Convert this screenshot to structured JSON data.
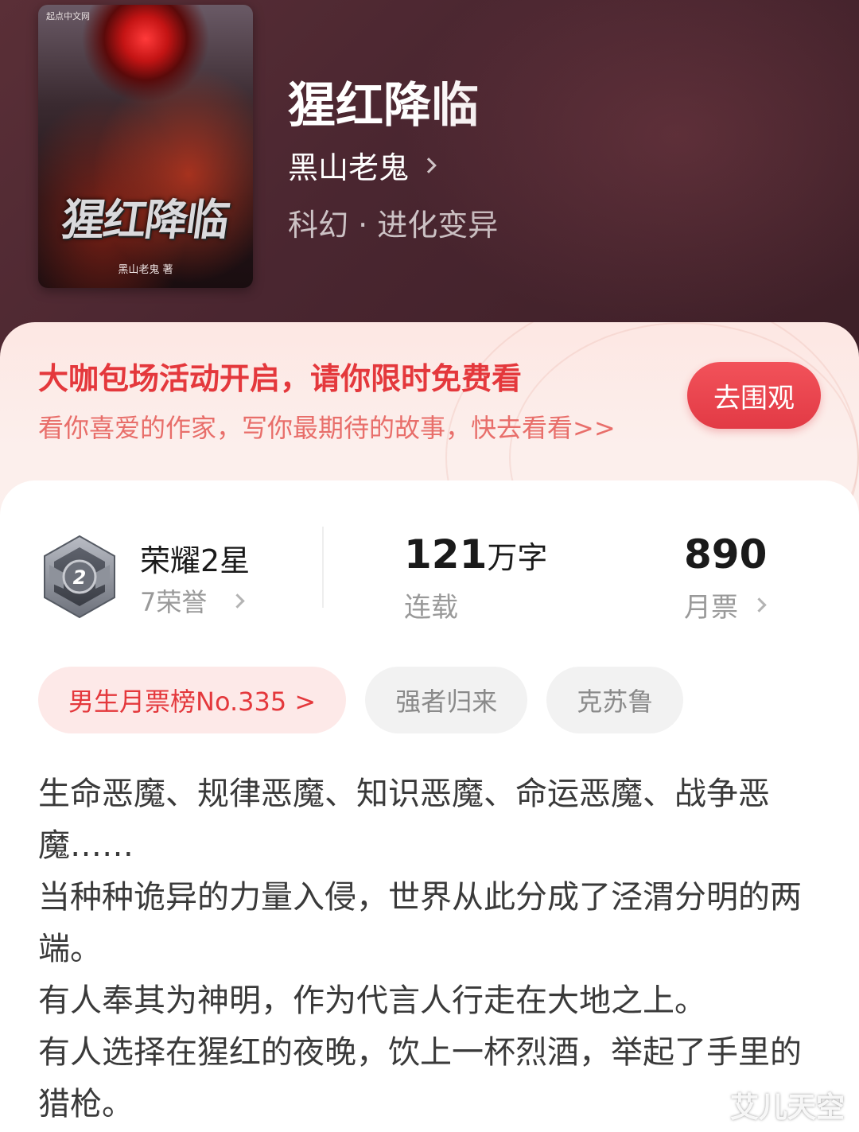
{
  "book": {
    "title": "猩红降临",
    "author": "黑山老鬼",
    "genre": "科幻 · 进化变异",
    "cover": {
      "title": "猩红降临",
      "author": "黑山老鬼 著",
      "publisher": "起点中文网"
    }
  },
  "promo": {
    "title": "大咖包场活动开启，请你限时免费看",
    "subtitle": "看你喜爱的作家，写你最期待的故事，快去看看>>",
    "button": "去围观"
  },
  "stats": {
    "honor_title": "荣耀2星",
    "honor_count": "7荣誉",
    "badge_level": "2",
    "words_num": "121",
    "words_unit": "万字",
    "status": "连载",
    "monthly_tickets": "890",
    "monthly_label": "月票"
  },
  "tags": [
    "男生月票榜No.335 >",
    "强者归来",
    "克苏鲁"
  ],
  "synopsis": [
    "生命恶魔、规律恶魔、知识恶魔、命运恶魔、战争恶魔……",
    "当种种诡异的力量入侵，世界从此分成了泾渭分明的两端。",
    "有人奉其为神明，作为代言人行走在大地之上。",
    "有人选择在猩红的夜晚，饮上一杯烈酒，举起了手里的猎枪。"
  ],
  "watermark": "艾儿天空",
  "colors": {
    "header_bg": "#4a2630",
    "accent_red": "#e4383c",
    "promo_bg": "#fde7e3"
  }
}
